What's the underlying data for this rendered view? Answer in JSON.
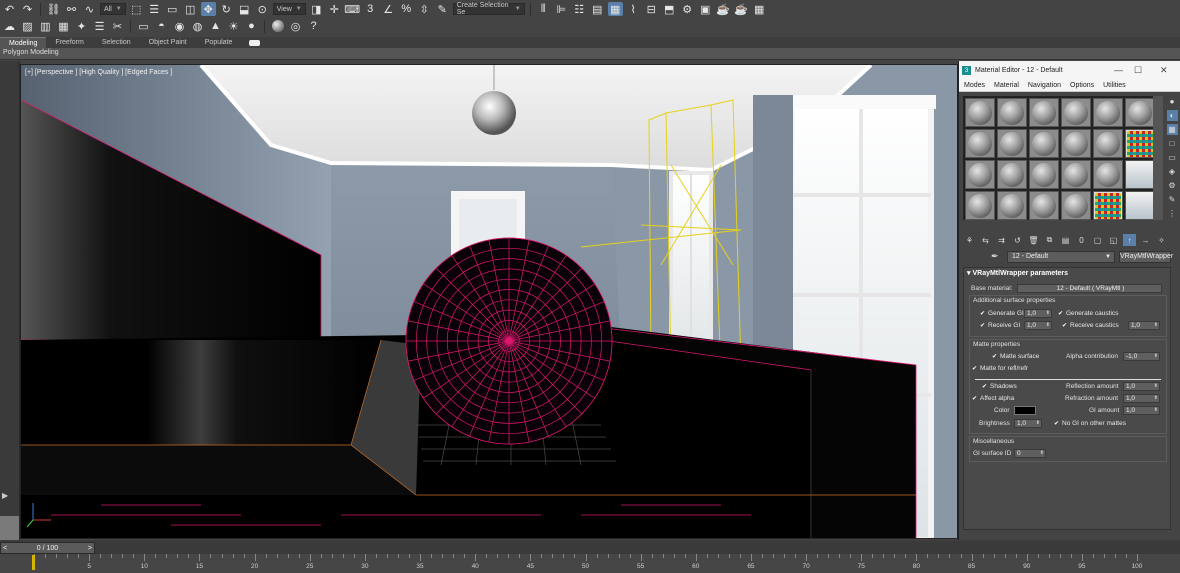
{
  "toolbar": {
    "selection_filter": "All",
    "ref_coord": "View",
    "named_selection_placeholder": "Create Selection Se"
  },
  "ribbon": {
    "tabs": [
      "Modeling",
      "Freeform",
      "Selection",
      "Object Paint",
      "Populate"
    ],
    "active_tab": "Modeling",
    "sub_label": "Polygon Modeling"
  },
  "viewport": {
    "label": "[+] [Perspective ] [High Quality ] [Edged Faces ]"
  },
  "material_editor": {
    "title": "Material Editor - 12 - Default",
    "menu": [
      "Modes",
      "Material",
      "Navigation",
      "Options",
      "Utilities"
    ],
    "material_name": "12 - Default",
    "material_type": "VRayMtlWrapper",
    "rollout_title": "VRayMtlWrapper parameters",
    "base_material_label": "Base material:",
    "base_material_value": "12 - Default  ( VRayMtl )",
    "additional_group": "Additional surface properties",
    "generate_gi_label": "Generate GI",
    "generate_gi_value": "1,0",
    "generate_caustics_label": "Generate caustics",
    "receive_gi_label": "Receive GI",
    "receive_gi_value": "1,0",
    "receive_caustics_label": "Receive caustics",
    "receive_caustics_value": "1,0",
    "matte_group": "Matte properties",
    "matte_surface_label": "Matte surface",
    "alpha_contribution_label": "Alpha contribution",
    "alpha_contribution_value": "-1,0",
    "matte_refl_label": "Matte for refl/refr",
    "shadows_label": "Shadows",
    "reflection_amount_label": "Reflection amount",
    "reflection_amount_value": "1,0",
    "affect_alpha_label": "Affect alpha",
    "refraction_amount_label": "Refraction amount",
    "refraction_amount_value": "1,0",
    "color_label": "Color",
    "gi_amount_label": "GI amount",
    "gi_amount_value": "1,0",
    "brightness_label": "Brightness",
    "brightness_value": "1,0",
    "no_gi_label": "No GI on other mattes",
    "misc_group": "Miscellaneous",
    "gi_surface_id_label": "GI surface ID",
    "gi_surface_id_value": "0"
  },
  "timeline": {
    "frame_display": "0 / 100",
    "ticks": [
      5,
      10,
      15,
      20,
      25,
      30,
      35,
      40,
      45,
      50,
      55,
      60,
      65,
      70,
      75,
      80,
      85,
      90,
      95,
      100
    ]
  },
  "colors": {
    "selection_wire": "#d9186e",
    "light_wire": "#e6d21a",
    "ui_bg": "#444444",
    "active_button": "#5a7fa8"
  }
}
